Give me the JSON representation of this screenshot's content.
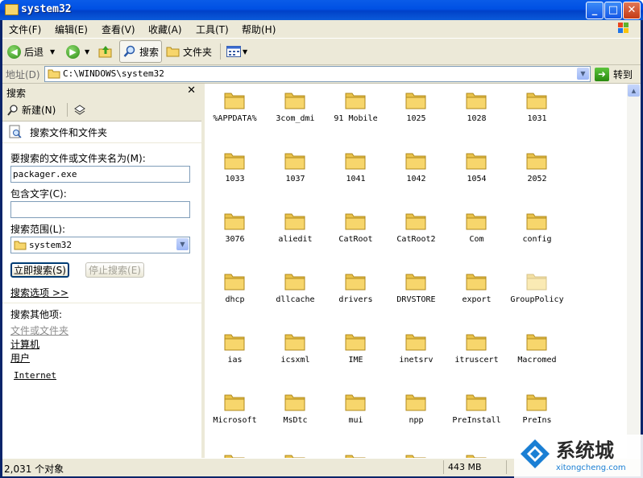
{
  "window": {
    "title": "system32"
  },
  "menu": [
    "文件(F)",
    "编辑(E)",
    "查看(V)",
    "收藏(A)",
    "工具(T)",
    "帮助(H)"
  ],
  "toolbar": {
    "back_label": "后退",
    "search_label": "搜索",
    "folders_label": "文件夹"
  },
  "address": {
    "label": "地址(D)",
    "path": "C:\\WINDOWS\\system32",
    "go_label": "转到"
  },
  "search_pane": {
    "title": "搜索",
    "new_label": "新建(N)",
    "heading": "搜索文件和文件夹",
    "name_label": "要搜索的文件或文件夹名为(M):",
    "name_value": "packager.exe",
    "contains_label": "包含文字(C):",
    "contains_value": "",
    "scope_label": "搜索范围(L):",
    "scope_value": "system32",
    "search_now": "立即搜索(S)",
    "stop_search": "停止搜索(E)",
    "options_link": "搜索选项 >>",
    "other_label": "搜索其他项:",
    "other_items": [
      "文件或文件夹",
      "计算机",
      "用户",
      "Internet"
    ]
  },
  "folders": [
    "%APPDATA%",
    "3com_dmi",
    "91 Mobile",
    "1025",
    "1028",
    "1031",
    "1033",
    "1037",
    "1041",
    "1042",
    "1054",
    "2052",
    "3076",
    "aliedit",
    "CatRoot",
    "CatRoot2",
    "Com",
    "config",
    "dhcp",
    "dllcache",
    "drivers",
    "DRVSTORE",
    "export",
    "GroupPolicy",
    "ias",
    "icsxml",
    "IME",
    "inetsrv",
    "itruscert",
    "Macromed",
    "Microsoft",
    "MsDtc",
    "mui",
    "npp",
    "PreInstall",
    "PreIns"
  ],
  "status": {
    "count": "2,031 个对象",
    "size": "443 MB"
  },
  "watermark": {
    "brand": "系统城",
    "url": "xitongcheng.com"
  },
  "colors": {
    "titlebar": "#0050e4",
    "chrome": "#ece9d8",
    "folder": "#f7d66c"
  }
}
